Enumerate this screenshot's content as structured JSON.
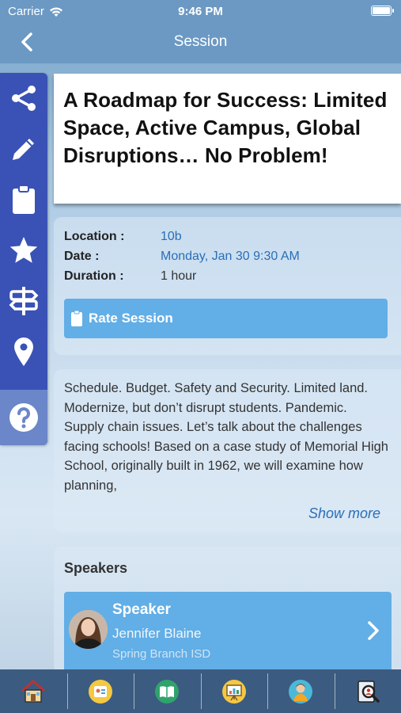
{
  "status_bar": {
    "carrier": "Carrier",
    "time": "9:46 PM"
  },
  "nav": {
    "title": "Session",
    "back_icon": "chevron-left-icon"
  },
  "side_toolbar": {
    "items": [
      {
        "icon": "share-icon"
      },
      {
        "icon": "pencil-icon"
      },
      {
        "icon": "clipboard-icon"
      },
      {
        "icon": "star-icon"
      },
      {
        "icon": "signpost-icon"
      },
      {
        "icon": "map-pin-icon"
      },
      {
        "icon": "help-icon"
      }
    ]
  },
  "session": {
    "title": "A Roadmap for Success: Limited Space, Active Campus, Global Disruptions… No Problem!",
    "location_label": "Location :",
    "location_value": "10b",
    "date_label": "Date :",
    "date_value": "Monday, Jan 30 9:30 AM",
    "duration_label": "Duration :",
    "duration_value": "1 hour",
    "rate_label": "Rate Session",
    "description": "Schedule. Budget. Safety and Security. Limited land. Modernize, but don’t disrupt students. Pandemic. Supply chain issues. Let’s talk about the challenges facing schools! Based on a case study of Memorial High School, originally built in 1962, we will examine how planning,",
    "show_more": "Show more"
  },
  "speakers": {
    "heading": "Speakers",
    "items": [
      {
        "role": "Speaker",
        "name": "Jennifer Blaine",
        "org": "Spring Branch ISD"
      }
    ]
  },
  "tab_bar": {
    "items": [
      {
        "icon": "home-icon"
      },
      {
        "icon": "badge-icon"
      },
      {
        "icon": "book-icon"
      },
      {
        "icon": "presentation-icon"
      },
      {
        "icon": "person-icon"
      },
      {
        "icon": "search-icon"
      }
    ]
  },
  "colors": {
    "toolbar": "#3a52b5",
    "accent_button": "#62aee6",
    "link": "#2a6fb6",
    "tab_bar": "#3c5b80"
  }
}
